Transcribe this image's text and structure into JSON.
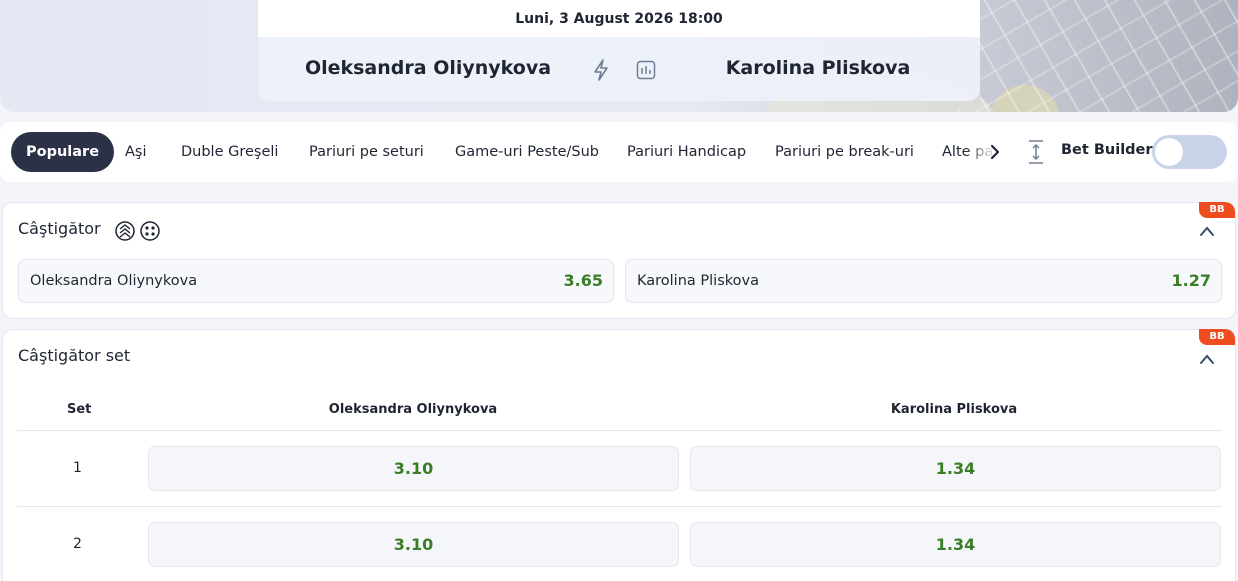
{
  "event": {
    "date": "Luni, 3 August 2026 18:00",
    "home": "Oleksandra Oliynykova",
    "away": "Karolina Pliskova",
    "icons": [
      "lightning-icon",
      "stats-icon"
    ]
  },
  "tabs": [
    {
      "label": "Populare",
      "active": true
    },
    {
      "label": "Aşi"
    },
    {
      "label": "Duble Greşeli"
    },
    {
      "label": "Pariuri pe seturi"
    },
    {
      "label": "Game-uri Peste/Sub"
    },
    {
      "label": "Pariuri Handicap"
    },
    {
      "label": "Pariuri pe break-uri"
    },
    {
      "label": "Alte pa"
    }
  ],
  "bet_builder": {
    "label": "Bet Builder",
    "enabled": false
  },
  "winner_market": {
    "title": "Câştigător",
    "badge": "BB",
    "outcomes": [
      {
        "name": "Oleksandra Oliynykova",
        "odd": "3.65"
      },
      {
        "name": "Karolina Pliskova",
        "odd": "1.27"
      }
    ]
  },
  "set_market": {
    "title": "Câştigător set",
    "badge": "BB",
    "headers": {
      "set": "Set",
      "home": "Oleksandra Oliynykova",
      "away": "Karolina Pliskova"
    },
    "rows": [
      {
        "set": "1",
        "home": "3.10",
        "away": "1.34"
      },
      {
        "set": "2",
        "home": "3.10",
        "away": "1.34"
      }
    ]
  },
  "colors": {
    "odd_green": "#3a7d27",
    "active_tab": "#2b3147",
    "badge": "#ef4d1f"
  }
}
